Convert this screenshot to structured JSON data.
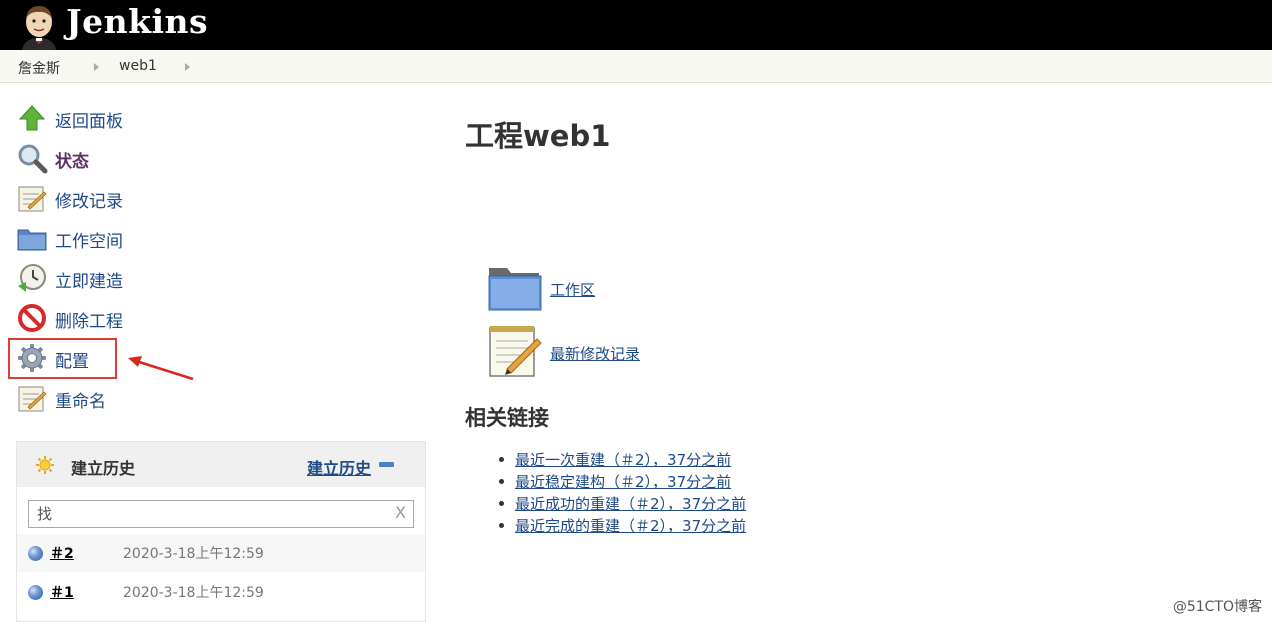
{
  "header": {
    "brand": "Jenkins",
    "logo_icon": "jenkins-butler-icon"
  },
  "breadcrumb": [
    {
      "label": "詹金斯"
    },
    {
      "label": "web1"
    }
  ],
  "sidebar": {
    "tasks": [
      {
        "label": "返回面板",
        "icon": "up-arrow-icon"
      },
      {
        "label": "状态",
        "icon": "search-icon",
        "active": true
      },
      {
        "label": "修改记录",
        "icon": "notepad-icon"
      },
      {
        "label": "工作空间",
        "icon": "folder-icon"
      },
      {
        "label": "立即建造",
        "icon": "clock-icon"
      },
      {
        "label": "删除工程",
        "icon": "no-entry-icon"
      },
      {
        "label": "配置",
        "icon": "gear-icon",
        "highlighted": true
      },
      {
        "label": "重命名",
        "icon": "notepad-icon"
      }
    ]
  },
  "build_history": {
    "title": "建立历史",
    "link": "建立历史",
    "search_placeholder": "找",
    "clear_label": "X",
    "builds": [
      {
        "number": "＃2",
        "time": "2020-3-18上午12:59"
      },
      {
        "number": "＃1",
        "time": "2020-3-18上午12:59"
      }
    ]
  },
  "main": {
    "title": "工程web1",
    "workspace_link": "工作区",
    "changes_link": "最新修改记录",
    "related_title": "相关链接",
    "related_links": [
      "最近一次重建（＃2），37分之前",
      "最近稳定建构（＃2），37分之前",
      "最近成功的重建（＃2），37分之前",
      "最近完成的重建（＃2），37分之前"
    ]
  },
  "watermark": "@51CTO博客",
  "colors": {
    "link": "#204a87",
    "header_bg": "#000000",
    "highlight": "#e03c31"
  }
}
